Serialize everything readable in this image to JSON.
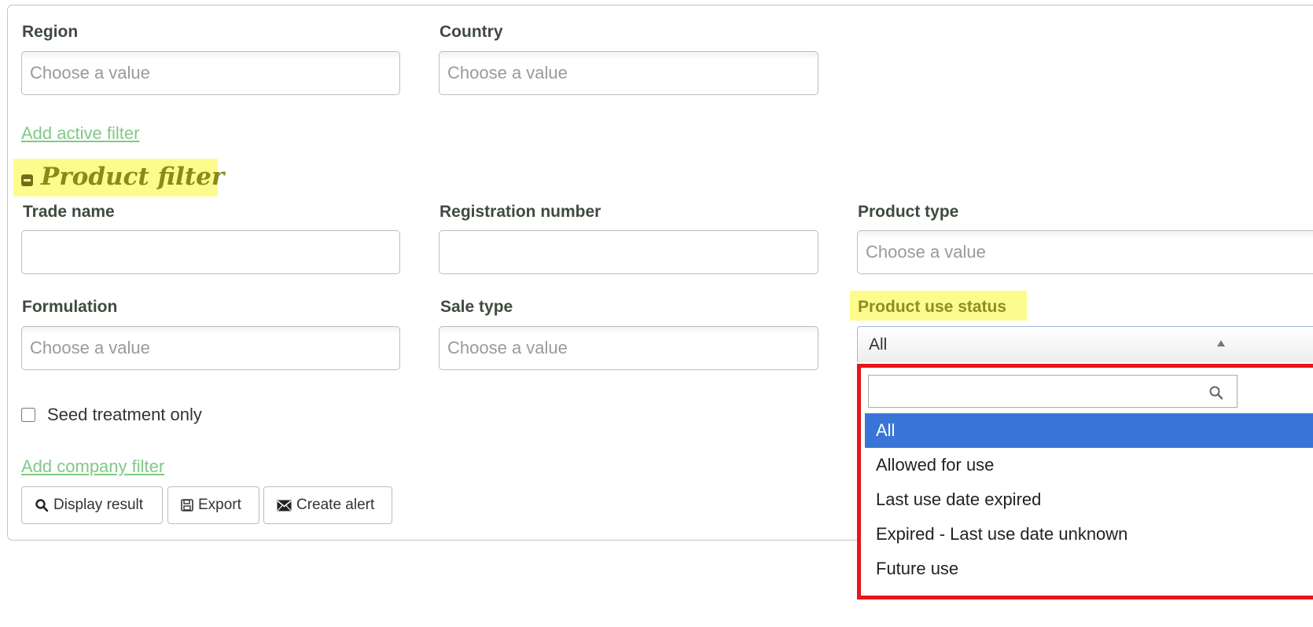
{
  "location_filter": {
    "region": {
      "label": "Region",
      "placeholder": "Choose a value"
    },
    "country": {
      "label": "Country",
      "placeholder": "Choose a value"
    },
    "add_active_filter": "Add active filter"
  },
  "product_filter": {
    "title": "Product filter",
    "trade_name": {
      "label": "Trade name",
      "value": ""
    },
    "registration_number": {
      "label": "Registration number",
      "value": ""
    },
    "product_type": {
      "label": "Product type",
      "placeholder": "Choose a value"
    },
    "formulation": {
      "label": "Formulation",
      "placeholder": "Choose a value"
    },
    "sale_type": {
      "label": "Sale type",
      "placeholder": "Choose a value"
    },
    "product_use_status": {
      "label": "Product use status",
      "selected": "All",
      "search_value": "",
      "options": [
        "All",
        "Allowed for use",
        "Last use date expired",
        "Expired - Last use date unknown",
        "Future use"
      ]
    },
    "seed_treatment_only": {
      "label": "Seed treatment only",
      "checked": false
    },
    "add_company_filter": "Add company filter"
  },
  "actions": {
    "display_result": "Display result",
    "export": "Export",
    "create_alert": "Create alert"
  },
  "colors": {
    "highlight": "#fcfc8e",
    "link": "#82c886",
    "selected_option": "#3875d7",
    "dropdown_outline": "#e8141b"
  }
}
